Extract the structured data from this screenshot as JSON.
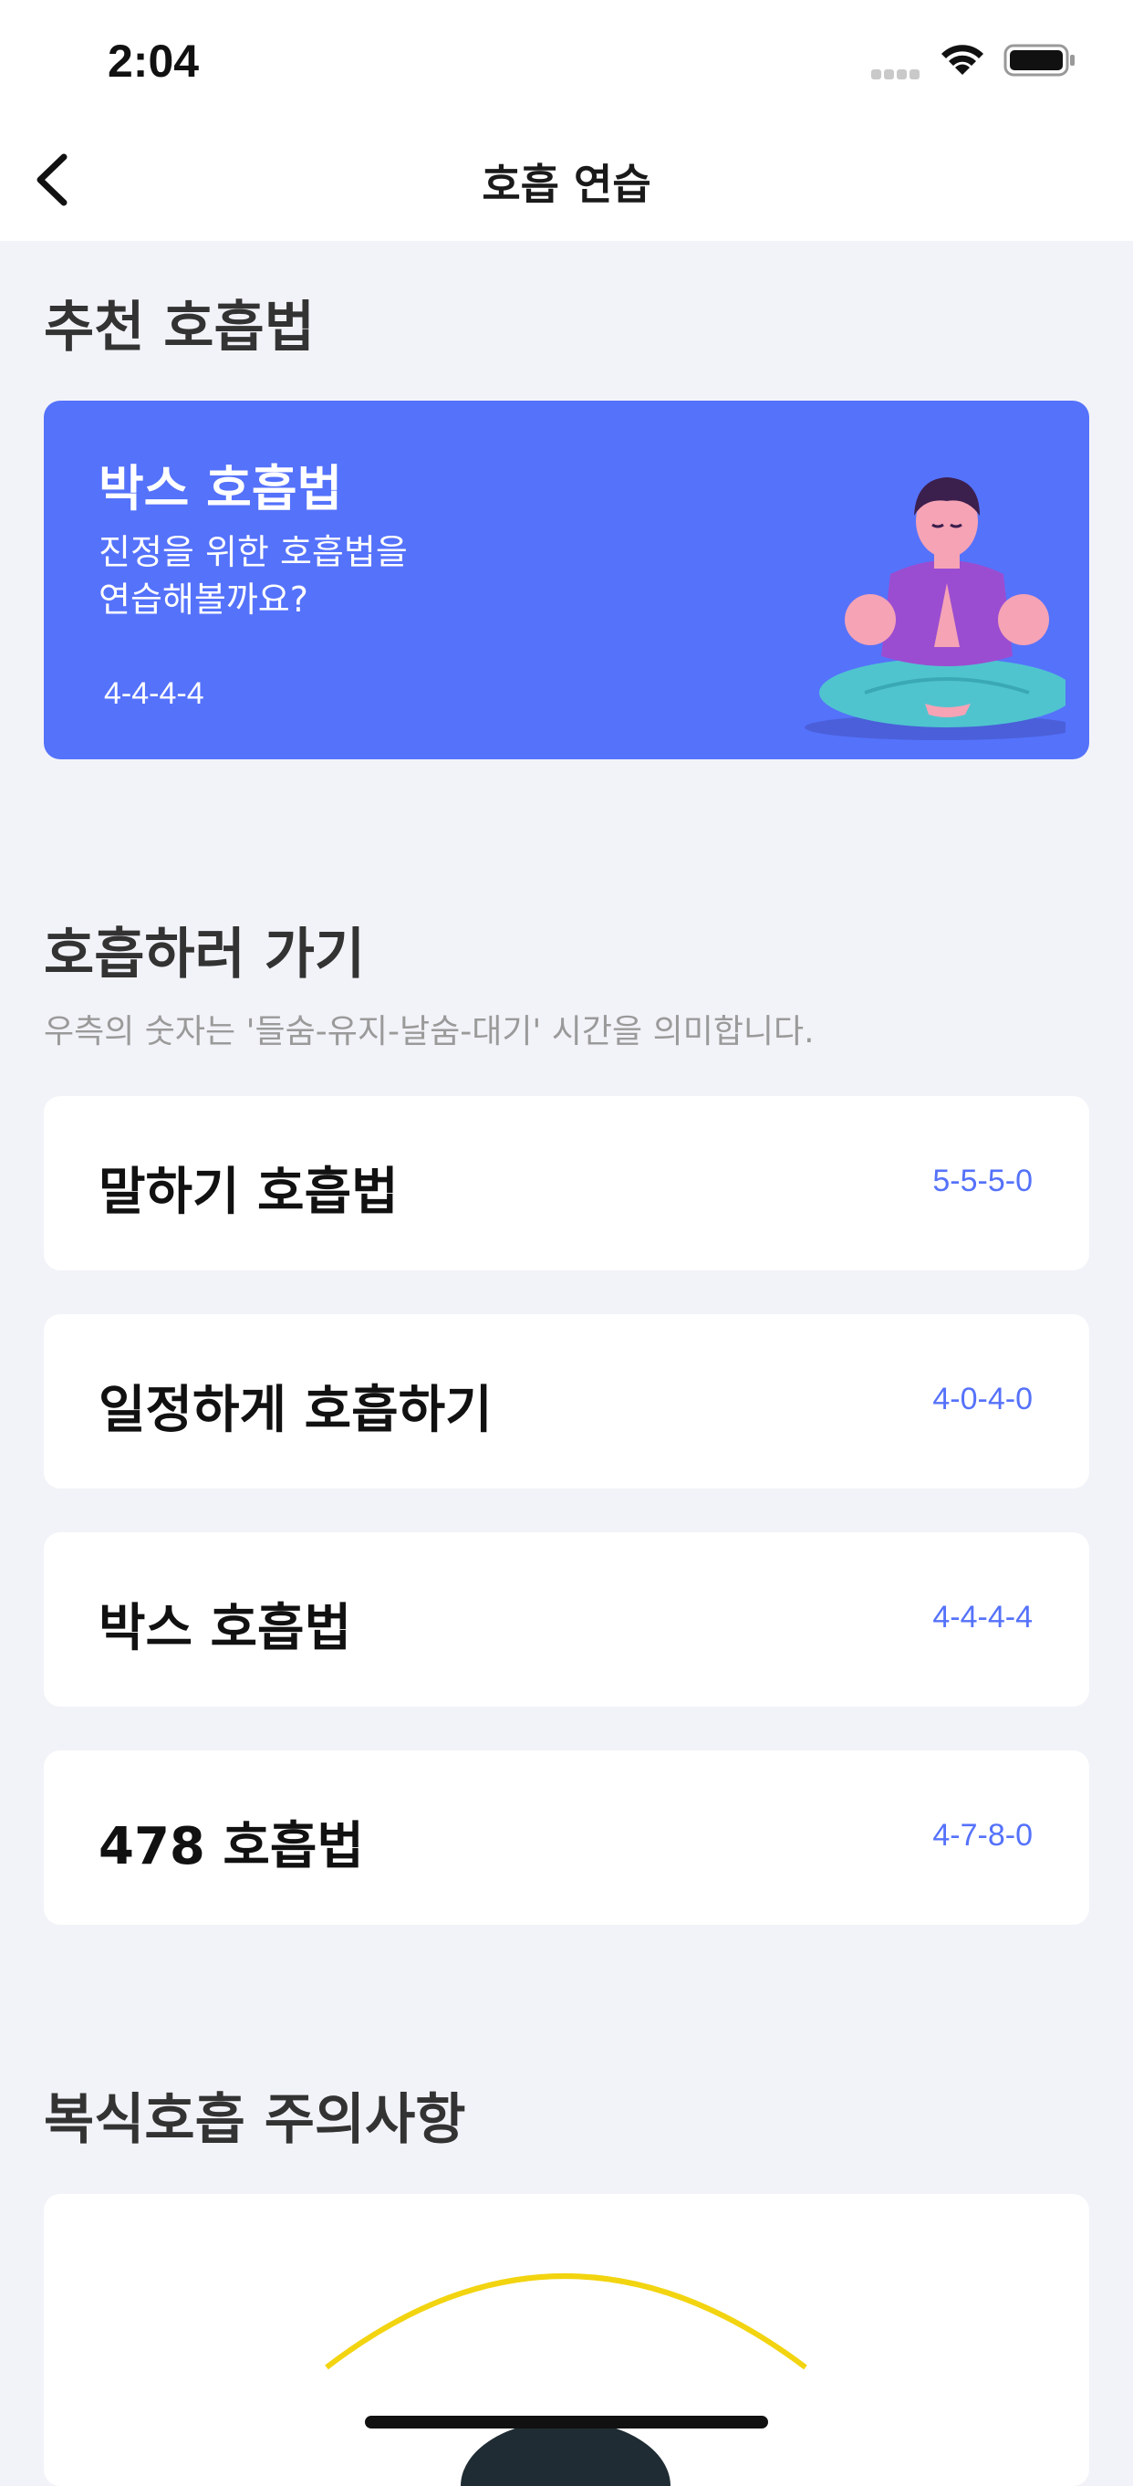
{
  "status_bar": {
    "time": "2:04"
  },
  "nav": {
    "title": "호흡 연습"
  },
  "recommended": {
    "section_title": "추천 호흡법",
    "card": {
      "title": "박스 호흡법",
      "description_line1": "진정을 위한 호흡법을",
      "description_line2": "연습해볼까요?",
      "pattern": "4-4-4-4"
    }
  },
  "breathing": {
    "section_title": "호흡하러 가기",
    "subtitle": "우측의 숫자는 '들숨-유지-날숨-대기' 시간을 의미합니다.",
    "items": [
      {
        "label": "말하기 호흡법",
        "pattern": "5-5-5-0"
      },
      {
        "label": "일정하게 호흡하기",
        "pattern": "4-0-4-0"
      },
      {
        "label": "박스 호흡법",
        "pattern": "4-4-4-4"
      },
      {
        "label": "478 호흡법",
        "pattern": "4-7-8-0"
      }
    ]
  },
  "caution": {
    "section_title": "복식호흡 주의사항"
  },
  "colors": {
    "accent": "#5572fb",
    "background": "#f2f3f8",
    "card": "#ffffff"
  }
}
